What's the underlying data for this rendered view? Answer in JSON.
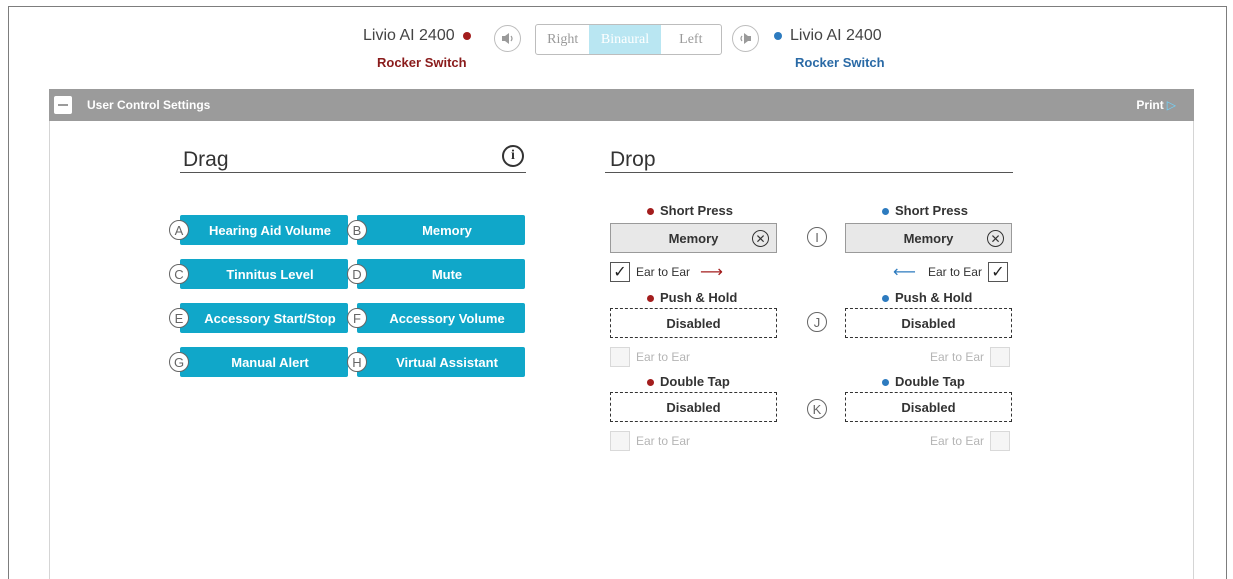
{
  "top_bar": {
    "left_device": {
      "name": "Livio AI 2400",
      "sub_label": "Rocker Switch",
      "color": "#a31d1d"
    },
    "right_device": {
      "name": "Livio AI 2400",
      "sub_label": "Rocker Switch",
      "color": "#2d7bbf"
    },
    "ear_selector": {
      "options": [
        "Right",
        "Binaural",
        "Left"
      ],
      "selected": "Binaural"
    },
    "left_speaker_icon": "speaker-left-icon",
    "right_speaker_icon": "speaker-right-icon"
  },
  "section": {
    "title": "User Control Settings",
    "print_label": "Print"
  },
  "drag": {
    "title": "Drag",
    "info_glyph": "i",
    "tiles": [
      {
        "letter": "A",
        "label": "Hearing Aid Volume"
      },
      {
        "letter": "B",
        "label": "Memory"
      },
      {
        "letter": "C",
        "label": "Tinnitus Level"
      },
      {
        "letter": "D",
        "label": "Mute"
      },
      {
        "letter": "E",
        "label": "Accessory Start/Stop"
      },
      {
        "letter": "F",
        "label": "Accessory Volume"
      },
      {
        "letter": "G",
        "label": "Manual Alert"
      },
      {
        "letter": "H",
        "label": "Virtual Assistant"
      }
    ]
  },
  "drop": {
    "title": "Drop",
    "remove_glyph": "✕",
    "ear_to_ear_label": "Ear to Ear",
    "check_glyph": "✓",
    "right_arrow": "⟶",
    "left_arrow": "⟵",
    "rows": [
      {
        "letter": "I",
        "left": {
          "label": "Short Press",
          "value": "Memory",
          "filled": true,
          "ear_to_ear": true
        },
        "right": {
          "label": "Short Press",
          "value": "Memory",
          "filled": true,
          "ear_to_ear": true
        }
      },
      {
        "letter": "J",
        "left": {
          "label": "Push & Hold",
          "value": "Disabled",
          "filled": false,
          "ear_to_ear": false
        },
        "right": {
          "label": "Push & Hold",
          "value": "Disabled",
          "filled": false,
          "ear_to_ear": false
        }
      },
      {
        "letter": "K",
        "left": {
          "label": "Double Tap",
          "value": "Disabled",
          "filled": false,
          "ear_to_ear": false
        },
        "right": {
          "label": "Double Tap",
          "value": "Disabled",
          "filled": false,
          "ear_to_ear": false
        }
      }
    ]
  },
  "colors": {
    "tile": "#10a7c9",
    "left_ear": "#a31d1d",
    "right_ear": "#2d7bbf",
    "header": "#9b9b9b"
  }
}
